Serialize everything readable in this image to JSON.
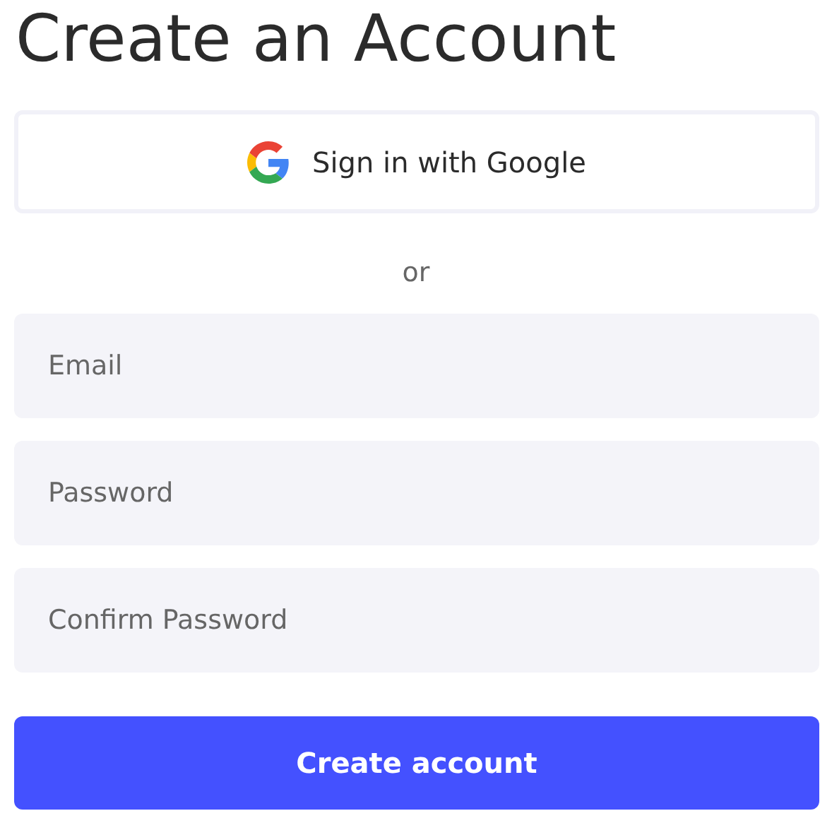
{
  "title": "Create an Account",
  "google_button": {
    "label": "Sign in with Google"
  },
  "divider": {
    "label": "or"
  },
  "fields": [
    {
      "placeholder": "Email"
    },
    {
      "placeholder": "Password"
    },
    {
      "placeholder": "Confirm Password"
    }
  ],
  "submit_button": {
    "label": "Create account"
  }
}
